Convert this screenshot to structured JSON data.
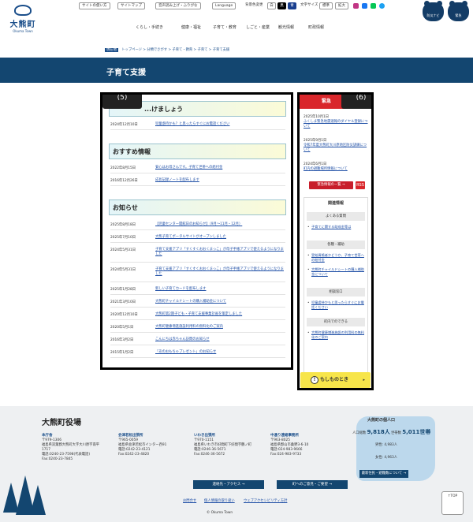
{
  "header": {
    "logo_text": "大熊町",
    "logo_sub": "Okuma Town",
    "util_howto": "サイトの使い方",
    "util_sitemap": "サイトマップ",
    "util_readaloud": "音声読み上げ・ふりがな",
    "util_language": "Language",
    "color_label": "背景色変更",
    "color_white": "白",
    "color_black": "黒",
    "color_blue": "青",
    "fontsize_label": "文字サイズ",
    "fontsize_normal": "標準",
    "fontsize_large": "拡大",
    "nav": [
      "くらし・手続き",
      "健康・福祉",
      "子育て・教育",
      "しごと・産業",
      "観光情報",
      "町政情報"
    ],
    "btn_disaster": "防災ナビ",
    "btn_emergency": "緊急"
  },
  "breadcrumb": {
    "here": "現在地",
    "items": "トップページ > 分類でさがす > 子育て・教育 > 子育て > 子育て支援"
  },
  "page_title": "子育て支援",
  "main": {
    "label": "(5)",
    "sec1_title": "...けましょう",
    "sec1_items": [
      {
        "date": "2024年12月10日",
        "title": "児童虐待かも？と思ったらすぐにお電話ください"
      }
    ],
    "sec2_title": "おすすめ情報",
    "sec2_items": [
      {
        "date": "2022年8月15日",
        "title": "安心はお母さんです。子育て世帯への給付金"
      },
      {
        "date": "2016年12月26日",
        "title": "成長記録ノートを配布します"
      }
    ],
    "sec3_title": "お知らせ",
    "sec3_items": [
      {
        "date": "2025年8月18日",
        "title": "【児童センター開館日のお知らせ】（9月～11月・12月）"
      },
      {
        "date": "2025年7月10日",
        "title": "大熊子育てポータルサイトがオープンしました"
      },
      {
        "date": "2024年5月31日",
        "title": "子育て支援アプリ「すくすくおおくまっこ」が母子手帳アプリで使えるようになりました"
      },
      {
        "date": "2024年5月31日",
        "title": "子育て支援アプリ「すくすくおおくまっこ」が母子手帳アプリで使えるようになりました"
      },
      {
        "date": "2025年1月28日",
        "title": "新しい子育てカードを配布します"
      },
      {
        "date": "2021年3月10日",
        "title": "大熊町チャイルドシートの購入補助金について"
      },
      {
        "date": "2020年12月10日",
        "title": "大熊町第2期子ども・子育て支援事業計画を策定しました"
      },
      {
        "date": "2020年5月1日",
        "title": "大熊町健康増進施設利用料の無料化のご案内"
      },
      {
        "date": "2016年3月2日",
        "title": "こんにちは赤ちゃん訪問のお知らせ"
      },
      {
        "date": "2015年1月2日",
        "title": "「あのおもちゃプレゼント」のお知らせ"
      }
    ]
  },
  "side": {
    "label": "(6)",
    "emerg_title": "緊急",
    "emerg_items": [
      {
        "date": "2025年10月1日",
        "title": "ふくしま緊急地震速報のダイヤル登録について"
      },
      {
        "date": "2025年9月1日",
        "title": "令和7年度大熊町大川原地区防災訓練について"
      },
      {
        "date": "2024年6月1日",
        "title": "町内の避難場所情報について"
      }
    ],
    "emerg_btn": "緊急情報の一覧 →",
    "rss": "RSS",
    "rel_title": "関連情報",
    "cat1": "よくある質問",
    "cat1_links": [
      "子育てに関する助成金等は"
    ],
    "cat2": "各種・補助",
    "cat2_links": [
      "受給資格者かどうか、子育て世帯への給付金",
      "大熊町チャイルドシートの購入補助金について"
    ],
    "cat3": "相談窓口",
    "cat3_links": [
      "児童虐待かもと思ったらすぐにお電話ください"
    ],
    "cat4": "町内でのできる",
    "cat4_links": [
      "大熊町健康増進施設の利用料の無料化のご案内"
    ],
    "moshimo": "もしものとき",
    "moshimo_icon": "!",
    "moshimo_arrow": "▸"
  },
  "footer": {
    "title": "大熊町役場",
    "offices": [
      {
        "name": "本庁舎",
        "lines": [
          "〒979-1306",
          "福島県双葉郡大熊町大字大川原字南平",
          "1717",
          "電話:0240-23-7598(代表電話)",
          "Fax:0240-23-7845"
        ]
      },
      {
        "name": "会津若松出張所",
        "lines": [
          "〒965-0059",
          "福島県会津若松市インター西91",
          "電話:0242-23-4121",
          "Fax:0242-23-4820"
        ]
      },
      {
        "name": "いわき出張所",
        "lines": [
          "〒970-1151",
          "福島県いわき市好間町下好間字鶴ノ町",
          "電話:0246-36-5671",
          "Fax:0246-36-5672"
        ]
      },
      {
        "name": "中通り連絡事務所",
        "lines": [
          "〒963-8025",
          "福島県郡山市桑野3-6-10",
          "電話:024-983-9666",
          "Fax:024-983-9733"
        ]
      }
    ],
    "btn_access": "連絡先・アクセス →",
    "btn_hours": "町へのご意見・ご要望 →",
    "links": [
      "お問合せ",
      "個人情報の取り扱い",
      "ウェブアクセシビリティ方針"
    ],
    "copyright": "© Okuma Town",
    "pop_title": "大熊町の個人口",
    "pop_total_label": "人口総数",
    "pop_total": "9,818人",
    "pop_households_label": "世帯数",
    "pop_households": "5,011世帯",
    "pop_male_label": "男性",
    "pop_male": "4,983人",
    "pop_female_label": "女性",
    "pop_female": "4,963人",
    "pop_btn": "最新住民・避難数について →",
    "totop": "↑TOP"
  }
}
